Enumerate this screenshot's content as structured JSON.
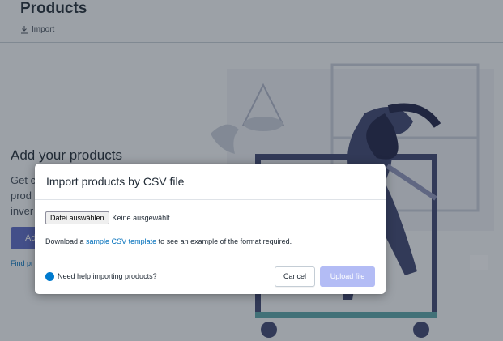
{
  "background": {
    "title": "Products",
    "import_label": "Import",
    "heading": "Add your products",
    "text_lines": [
      "Get c",
      "prod",
      "inver"
    ],
    "button_label": "Ad",
    "link_text": "Find pr"
  },
  "modal": {
    "title": "Import products by CSV file",
    "file_button_label": "Datei auswählen",
    "file_status": "Keine ausgewählt",
    "download_prefix": "Download a ",
    "download_link": "sample CSV template",
    "download_suffix": " to see an example of the format required.",
    "help_text": "Need help importing products?",
    "cancel_label": "Cancel",
    "upload_label": "Upload file"
  },
  "colors": {
    "accent": "#5c6ac4",
    "link": "#006fbb",
    "upload_disabled": "#b3bcf5",
    "help_icon": "#007ace"
  }
}
